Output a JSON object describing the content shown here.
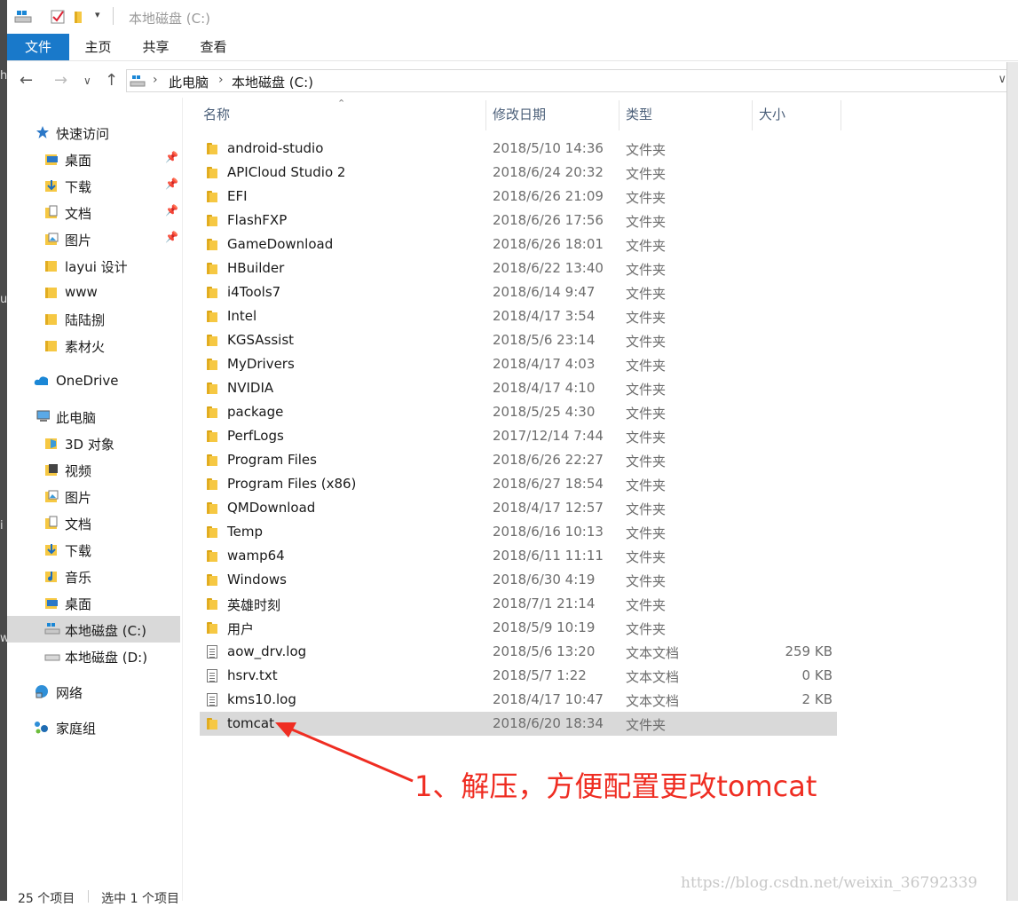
{
  "window": {
    "title": "本地磁盘 (C:)"
  },
  "ribbon": {
    "tabs": [
      "文件",
      "主页",
      "共享",
      "查看"
    ]
  },
  "address": {
    "segments": [
      "此电脑",
      "本地磁盘 (C:)"
    ]
  },
  "sidebar": {
    "quick_access": "快速访问",
    "quick_items": [
      {
        "label": "桌面",
        "pinned": true
      },
      {
        "label": "下载",
        "pinned": true
      },
      {
        "label": "文档",
        "pinned": true
      },
      {
        "label": "图片",
        "pinned": true
      },
      {
        "label": "layui 设计",
        "pinned": false
      },
      {
        "label": "www",
        "pinned": false
      },
      {
        "label": "陆陆捌",
        "pinned": false
      },
      {
        "label": "素材火",
        "pinned": false
      }
    ],
    "onedrive": "OneDrive",
    "this_pc": "此电脑",
    "pc_items": [
      "3D 对象",
      "视频",
      "图片",
      "文档",
      "下载",
      "音乐",
      "桌面",
      "本地磁盘 (C:)",
      "本地磁盘 (D:)"
    ],
    "network": "网络",
    "homegroup": "家庭组"
  },
  "columns": {
    "name": "名称",
    "date": "修改日期",
    "type": "类型",
    "size": "大小"
  },
  "files": [
    {
      "name": "android-studio",
      "date": "2018/5/10 14:36",
      "type": "文件夹",
      "size": "",
      "kind": "folder"
    },
    {
      "name": "APICloud Studio 2",
      "date": "2018/6/24 20:32",
      "type": "文件夹",
      "size": "",
      "kind": "folder"
    },
    {
      "name": "EFI",
      "date": "2018/6/26 21:09",
      "type": "文件夹",
      "size": "",
      "kind": "folder"
    },
    {
      "name": "FlashFXP",
      "date": "2018/6/26 17:56",
      "type": "文件夹",
      "size": "",
      "kind": "folder"
    },
    {
      "name": "GameDownload",
      "date": "2018/6/26 18:01",
      "type": "文件夹",
      "size": "",
      "kind": "folder"
    },
    {
      "name": "HBuilder",
      "date": "2018/6/22 13:40",
      "type": "文件夹",
      "size": "",
      "kind": "folder"
    },
    {
      "name": "i4Tools7",
      "date": "2018/6/14 9:47",
      "type": "文件夹",
      "size": "",
      "kind": "folder"
    },
    {
      "name": "Intel",
      "date": "2018/4/17 3:54",
      "type": "文件夹",
      "size": "",
      "kind": "folder"
    },
    {
      "name": "KGSAssist",
      "date": "2018/5/6 23:14",
      "type": "文件夹",
      "size": "",
      "kind": "folder"
    },
    {
      "name": "MyDrivers",
      "date": "2018/4/17 4:03",
      "type": "文件夹",
      "size": "",
      "kind": "folder"
    },
    {
      "name": "NVIDIA",
      "date": "2018/4/17 4:10",
      "type": "文件夹",
      "size": "",
      "kind": "folder"
    },
    {
      "name": "package",
      "date": "2018/5/25 4:30",
      "type": "文件夹",
      "size": "",
      "kind": "folder"
    },
    {
      "name": "PerfLogs",
      "date": "2017/12/14 7:44",
      "type": "文件夹",
      "size": "",
      "kind": "folder"
    },
    {
      "name": "Program Files",
      "date": "2018/6/26 22:27",
      "type": "文件夹",
      "size": "",
      "kind": "folder"
    },
    {
      "name": "Program Files (x86)",
      "date": "2018/6/27 18:54",
      "type": "文件夹",
      "size": "",
      "kind": "folder"
    },
    {
      "name": "QMDownload",
      "date": "2018/4/17 12:57",
      "type": "文件夹",
      "size": "",
      "kind": "folder"
    },
    {
      "name": "Temp",
      "date": "2018/6/16 10:13",
      "type": "文件夹",
      "size": "",
      "kind": "folder"
    },
    {
      "name": "wamp64",
      "date": "2018/6/11 11:11",
      "type": "文件夹",
      "size": "",
      "kind": "folder"
    },
    {
      "name": "Windows",
      "date": "2018/6/30 4:19",
      "type": "文件夹",
      "size": "",
      "kind": "folder"
    },
    {
      "name": "英雄时刻",
      "date": "2018/7/1 21:14",
      "type": "文件夹",
      "size": "",
      "kind": "folder"
    },
    {
      "name": "用户",
      "date": "2018/5/9 10:19",
      "type": "文件夹",
      "size": "",
      "kind": "folder"
    },
    {
      "name": "aow_drv.log",
      "date": "2018/5/6 13:20",
      "type": "文本文档",
      "size": "259 KB",
      "kind": "doc"
    },
    {
      "name": "hsrv.txt",
      "date": "2018/5/7 1:22",
      "type": "文本文档",
      "size": "0 KB",
      "kind": "doc"
    },
    {
      "name": "kms10.log",
      "date": "2018/4/17 10:47",
      "type": "文本文档",
      "size": "2 KB",
      "kind": "doc"
    },
    {
      "name": "tomcat",
      "date": "2018/6/20 18:34",
      "type": "文件夹",
      "size": "",
      "kind": "folder",
      "selected": true
    }
  ],
  "annotation": {
    "text": "1、解压，方便配置更改tomcat",
    "color": "#ef2d22"
  },
  "status": {
    "count": "25 个项目",
    "selected": "选中 1 个项目"
  },
  "watermark": "https://blog.csdn.net/weixin_36792339",
  "colors": {
    "accent": "#1979ca",
    "folder": "#f6c843",
    "selection": "#d9d9d9"
  }
}
